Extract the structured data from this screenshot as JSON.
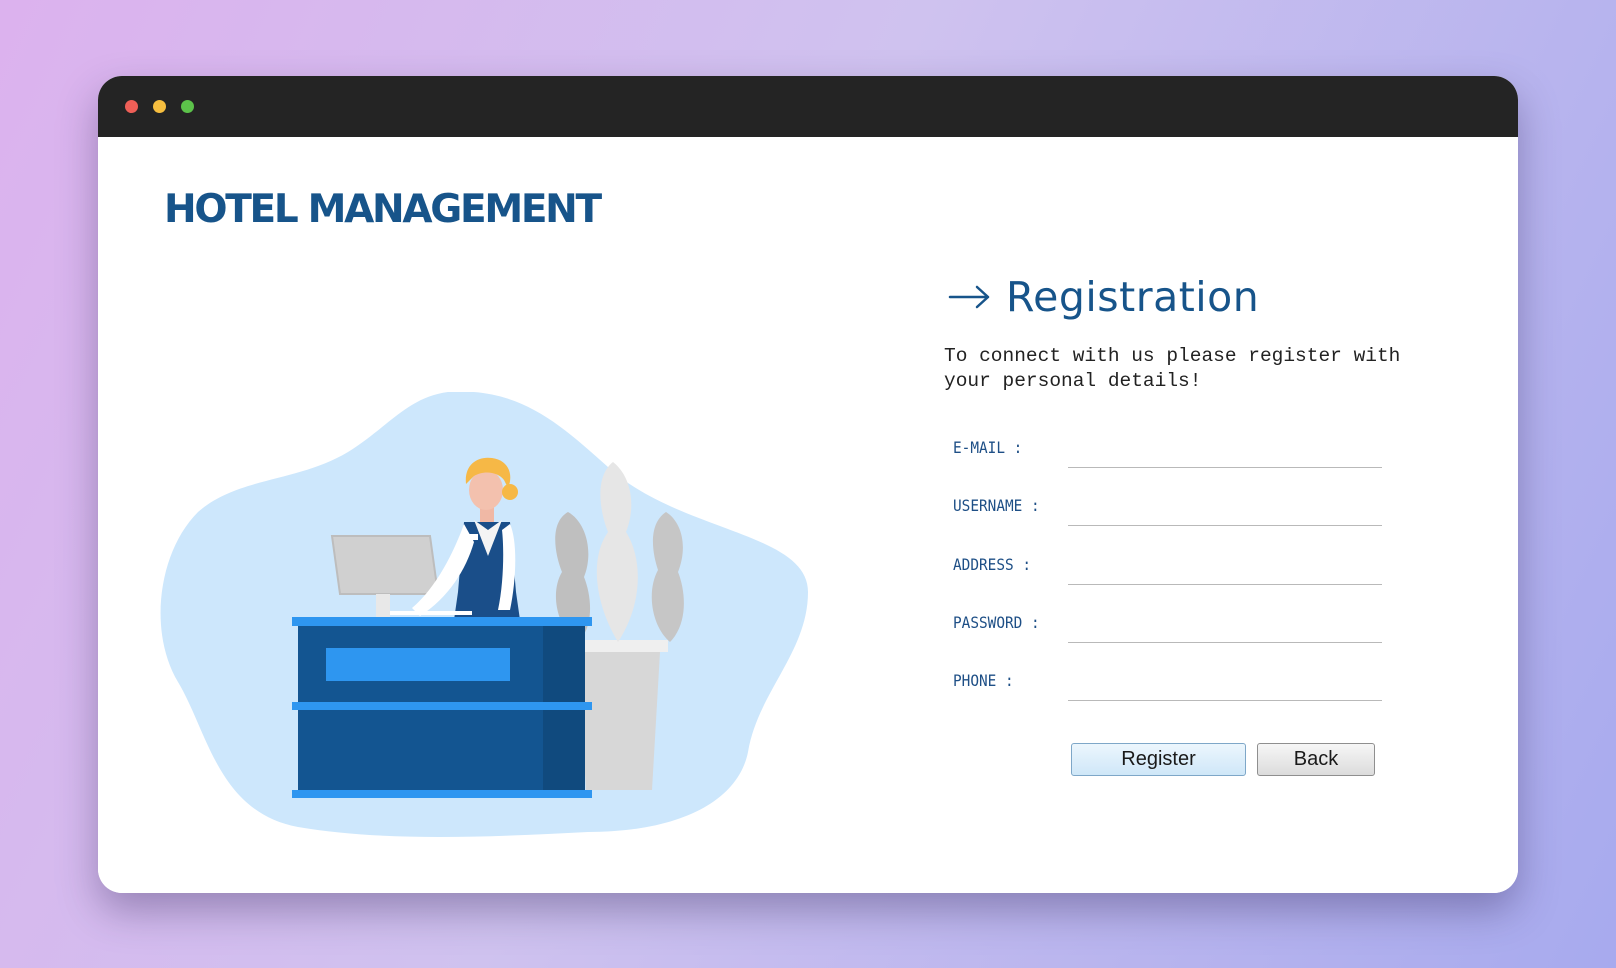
{
  "window": {
    "controls": [
      "close",
      "minimize",
      "maximize"
    ],
    "colors": {
      "close": "#ee5f57",
      "minimize": "#f6be3f",
      "maximize": "#5cc24a"
    }
  },
  "brand": {
    "title": "HOTEL MANAGEMENT",
    "color": "#17548a"
  },
  "illustration": {
    "subject": "hotel receptionist at front desk with computer and potted plant"
  },
  "form": {
    "heading": "Registration",
    "heading_icon": "arrow-right-icon",
    "subtitle_line1": "To connect with us please register with",
    "subtitle_line2": "your personal details!",
    "fields": [
      {
        "label": "E-MAIL :",
        "value": ""
      },
      {
        "label": "USERNAME :",
        "value": ""
      },
      {
        "label": "ADDRESS :",
        "value": ""
      },
      {
        "label": "PASSWORD :",
        "value": ""
      },
      {
        "label": "PHONE :",
        "value": ""
      }
    ],
    "buttons": {
      "register": "Register",
      "back": "Back"
    }
  }
}
